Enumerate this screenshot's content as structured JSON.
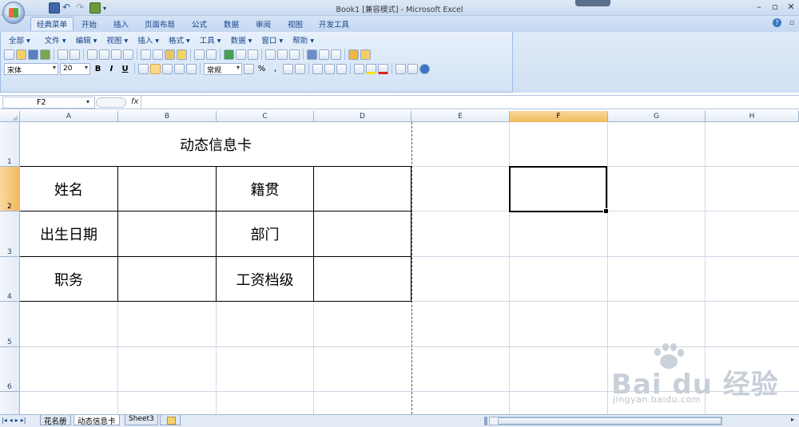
{
  "window": {
    "title": "Book1  [兼容模式] - Microsoft Excel"
  },
  "tabs": [
    "经典菜单",
    "开始",
    "插入",
    "页面布局",
    "公式",
    "数据",
    "审阅",
    "视图",
    "开发工具"
  ],
  "menu": [
    "全部 ▾",
    "文件 ▾",
    "编辑 ▾",
    "视图 ▾",
    "插入 ▾",
    "格式 ▾",
    "工具 ▾",
    "数据 ▾",
    "窗口 ▾",
    "帮助 ▾"
  ],
  "format": {
    "font": "宋体",
    "size": "20",
    "number_format": "常规",
    "bold": "B",
    "italic": "I",
    "underline": "U",
    "percent": "%",
    "comma": ","
  },
  "formula_bar": {
    "name_box": "F2",
    "fx": "fx",
    "content": ""
  },
  "columns": [
    "A",
    "B",
    "C",
    "D",
    "E",
    "F",
    "G",
    "H"
  ],
  "selected_column": "F",
  "rows": [
    "1",
    "2",
    "3",
    "4",
    "5",
    "6"
  ],
  "selected_row": "2",
  "cells": {
    "title": "动态信息卡",
    "a2": "姓名",
    "c2": "籍贯",
    "a3": "出生日期",
    "c3": "部门",
    "a4": "职务",
    "c4": "工资档级"
  },
  "sheets": [
    "花名册",
    "动态信息卡",
    "Sheet3"
  ],
  "active_sheet": "动态信息卡",
  "watermark": {
    "main": "Bai du 经验",
    "sub": "jingyan.baidu.com"
  },
  "colors": {
    "accent": "#15428b",
    "selection": "#f1b85b",
    "ribbon": "#d2e2f5"
  }
}
